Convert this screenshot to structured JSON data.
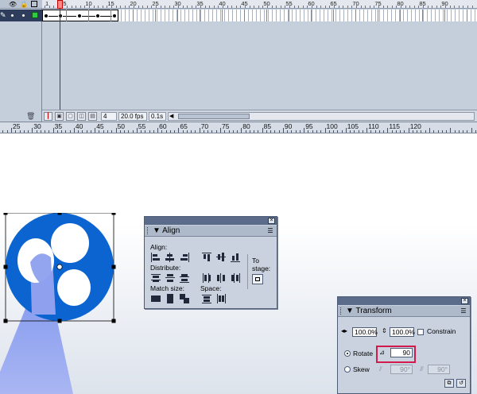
{
  "timeline": {
    "frame_numbers": [
      "1",
      "5",
      "10",
      "15",
      "20",
      "25",
      "30",
      "35",
      "40",
      "45",
      "50",
      "55",
      "60",
      "65",
      "70",
      "75",
      "80",
      "85",
      "90"
    ],
    "current_frame": "4",
    "frame_rate": "20.0 fps",
    "elapsed_time": "0.1s",
    "icons": {
      "eye": "eye-icon",
      "lock": "lock-icon",
      "outline": "outline-icon",
      "pencil": "pencil-icon",
      "trash": "trash-icon"
    },
    "layer_color": "#2ecc40"
  },
  "stage_ruler": {
    "labels": [
      "25",
      "30",
      "35",
      "40",
      "45",
      "50",
      "55",
      "60",
      "65",
      "70",
      "75",
      "80",
      "85",
      "90",
      "95",
      "100",
      "105",
      "110",
      "115",
      "120"
    ]
  },
  "align_panel": {
    "title": "Align",
    "align_label": "Align:",
    "distribute_label": "Distribute:",
    "match_size_label": "Match size:",
    "space_label": "Space:",
    "to_stage_line1": "To",
    "to_stage_line2": "stage:"
  },
  "transform_panel": {
    "title": "Transform",
    "width_value": "100.0%",
    "height_value": "100.0%",
    "constrain_label": "Constrain",
    "rotate_label": "Rotate",
    "rotate_value": "90",
    "skew_label": "Skew",
    "skew_h_value": "90°",
    "skew_v_value": "90°",
    "rotate_selected": true
  },
  "colors": {
    "fan_blue": "#0b64d0",
    "stem_blue": "#8ea0ee",
    "highlight": "#d21b4c",
    "playhead": "#e00000"
  }
}
